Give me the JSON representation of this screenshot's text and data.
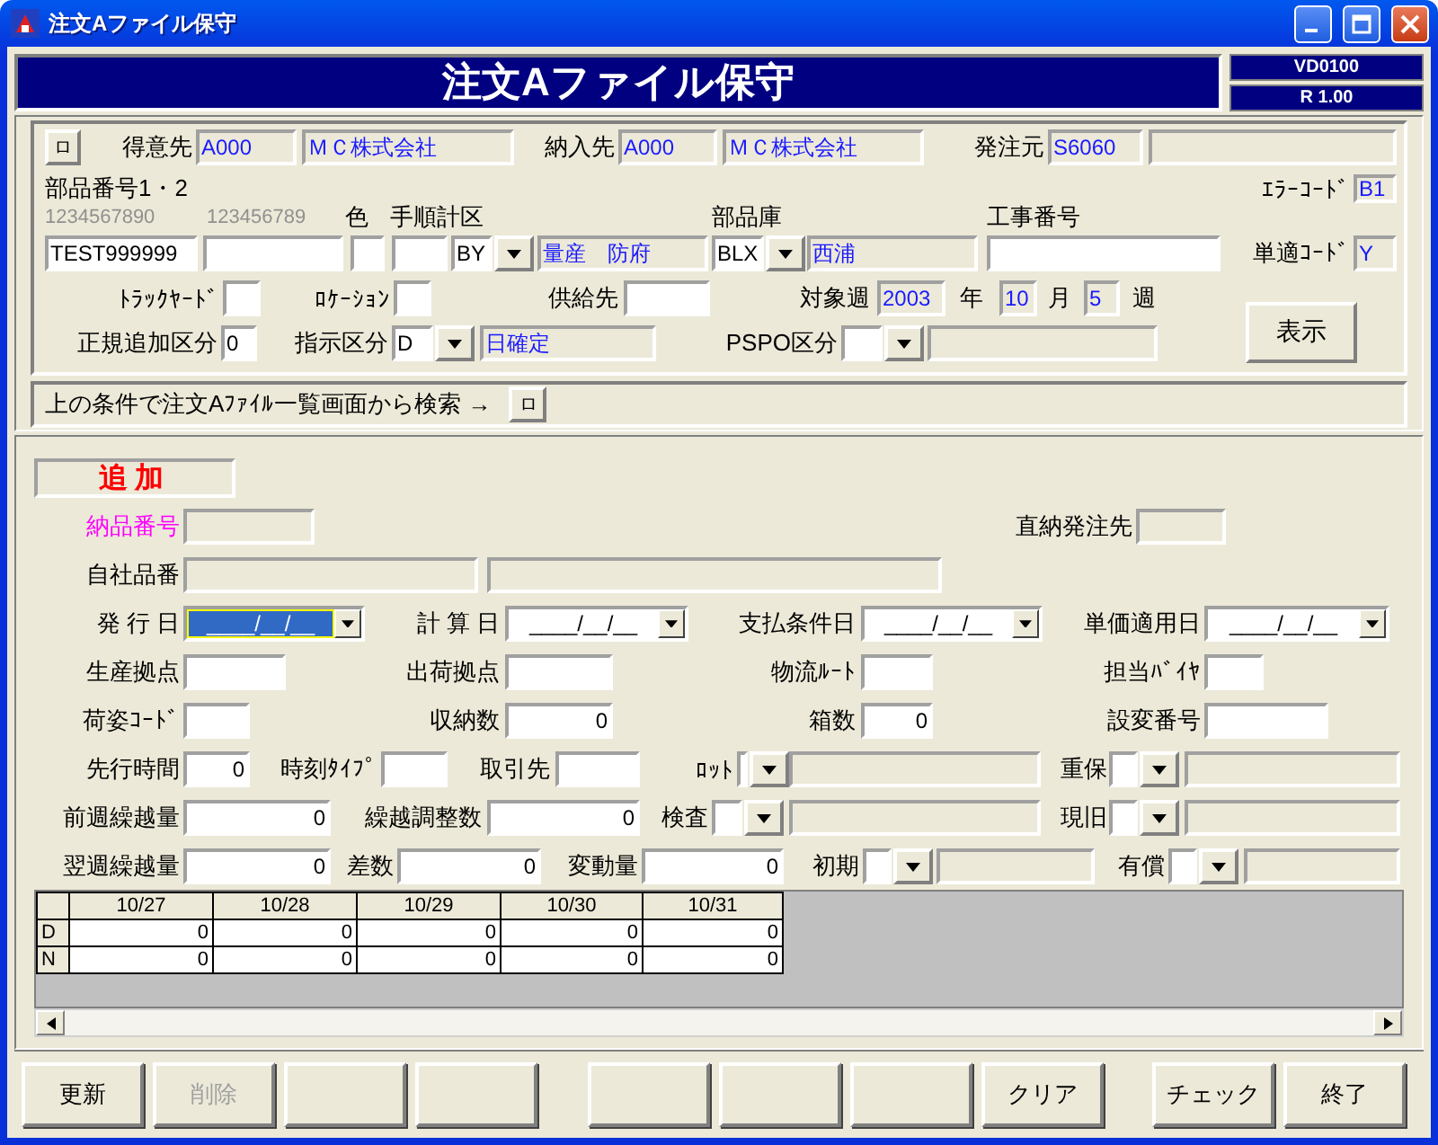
{
  "window": {
    "title": "注文Aファイル保守"
  },
  "header": {
    "title": "注文Aファイル保守",
    "code": "VD0100",
    "revision": "R 1.00"
  },
  "search": {
    "lines": [
      {
        "items": [
          {
            "kind": "button",
            "label": "ロ"
          },
          {
            "kind": "label",
            "text": "得意先"
          },
          {
            "kind": "field",
            "value": "A000",
            "readonly": true
          },
          {
            "kind": "field",
            "value": "ＭＣ株式会社",
            "readonly": true
          },
          {
            "kind": "label",
            "text": "納入先"
          },
          {
            "kind": "field",
            "value": "A000",
            "readonly": true
          },
          {
            "kind": "field",
            "value": "ＭＣ株式会社",
            "readonly": true
          },
          {
            "kind": "label",
            "text": "発注元"
          },
          {
            "kind": "field",
            "value": "S6060",
            "readonly": true
          },
          {
            "kind": "field",
            "readonly": true
          }
        ]
      },
      {
        "items": [
          {
            "kind": "label",
            "text": "部品番号1・2"
          },
          {
            "kind": "label",
            "text": "ｴﾗｰｺｰﾄﾞ"
          },
          {
            "kind": "field",
            "value": "B1",
            "readonly": true
          }
        ]
      },
      {
        "items": [
          {
            "kind": "ruler",
            "text": "1234567890"
          },
          {
            "kind": "ruler",
            "text": "123456789"
          },
          {
            "kind": "label",
            "text": "色"
          },
          {
            "kind": "label",
            "text": "手順計区"
          },
          {
            "kind": "label",
            "text": "部品庫"
          },
          {
            "kind": "label",
            "text": "工事番号"
          }
        ]
      },
      {
        "items": [
          {
            "kind": "field",
            "value": "TEST999999",
            "readonly": false
          },
          {
            "kind": "field",
            "readonly": false
          },
          {
            "kind": "field",
            "readonly": false
          },
          {
            "kind": "field",
            "readonly": false
          },
          {
            "kind": "combo",
            "value": "BY"
          },
          {
            "kind": "field",
            "value": "量産　防府",
            "readonly": true
          },
          {
            "kind": "combo",
            "value": "BLX"
          },
          {
            "kind": "field",
            "value": "西浦",
            "readonly": true
          },
          {
            "kind": "field",
            "readonly": false
          },
          {
            "kind": "label",
            "text": "単適ｺｰﾄﾞ"
          },
          {
            "kind": "field",
            "value": "Y",
            "readonly": true
          }
        ]
      },
      {
        "items": [
          {
            "kind": "label",
            "text": "ﾄﾗｯｸﾔｰﾄﾞ"
          },
          {
            "kind": "field",
            "readonly": false
          },
          {
            "kind": "label",
            "text": "ﾛｹｰｼｮﾝ"
          },
          {
            "kind": "field",
            "readonly": false
          },
          {
            "kind": "label",
            "text": "供給先"
          },
          {
            "kind": "field",
            "readonly": false
          },
          {
            "kind": "label",
            "text": "対象週"
          },
          {
            "kind": "field",
            "value": "2003",
            "readonly": true
          },
          {
            "kind": "label",
            "text": "年"
          },
          {
            "kind": "field",
            "value": "10",
            "readonly": true
          },
          {
            "kind": "label",
            "text": "月"
          },
          {
            "kind": "field",
            "value": "5",
            "readonly": true
          },
          {
            "kind": "label",
            "text": "週"
          }
        ]
      },
      {
        "items": [
          {
            "kind": "label",
            "text": "正規追加区分"
          },
          {
            "kind": "field",
            "value": "0",
            "readonly": false
          },
          {
            "kind": "label",
            "text": "指示区分"
          },
          {
            "kind": "combo",
            "value": "D"
          },
          {
            "kind": "field",
            "value": "日確定",
            "readonly": true
          },
          {
            "kind": "label",
            "text": "PSPO区分"
          },
          {
            "kind": "combo"
          },
          {
            "kind": "field",
            "readonly": true
          }
        ]
      }
    ],
    "show_button": "表示",
    "lookup": {
      "text": "上の条件で注文Aﾌｧｲﾙ一覧画面から検索 →",
      "button": "ロ"
    }
  },
  "detail": {
    "mode": "追加",
    "lines": [
      {
        "items": [
          {
            "kind": "label",
            "text": "納品番号",
            "color": "#ff00ff"
          },
          {
            "kind": "field",
            "readonly": true
          },
          {
            "kind": "label",
            "text": "直納発注先"
          },
          {
            "kind": "field",
            "readonly": true
          }
        ]
      },
      {
        "items": [
          {
            "kind": "label",
            "text": "自社品番"
          },
          {
            "kind": "field",
            "readonly": true
          },
          {
            "kind": "field",
            "readonly": true
          }
        ]
      },
      {
        "items": [
          {
            "kind": "label",
            "text": "発 行 日"
          },
          {
            "kind": "date",
            "mask": "____/__/__",
            "focused": true
          },
          {
            "kind": "label",
            "text": "計 算 日"
          },
          {
            "kind": "date",
            "mask": "____/__/__",
            "focused": false
          },
          {
            "kind": "label",
            "text": "支払条件日"
          },
          {
            "kind": "date",
            "mask": "____/__/__",
            "focused": false
          },
          {
            "kind": "label",
            "text": "単価適用日"
          },
          {
            "kind": "date",
            "mask": "____/__/__",
            "focused": false
          }
        ]
      },
      {
        "items": [
          {
            "kind": "label",
            "text": "生産拠点"
          },
          {
            "kind": "field",
            "readonly": false
          },
          {
            "kind": "label",
            "text": "出荷拠点"
          },
          {
            "kind": "field",
            "readonly": false
          },
          {
            "kind": "label",
            "text": "物流ﾙｰﾄ"
          },
          {
            "kind": "field",
            "readonly": false
          },
          {
            "kind": "label",
            "text": "担当ﾊﾞｲﾔ"
          },
          {
            "kind": "field",
            "readonly": false
          }
        ]
      },
      {
        "items": [
          {
            "kind": "label",
            "text": "荷姿ｺｰﾄﾞ"
          },
          {
            "kind": "field",
            "readonly": false
          },
          {
            "kind": "label",
            "text": "収納数"
          },
          {
            "kind": "field",
            "value": "0",
            "readonly": false
          },
          {
            "kind": "label",
            "text": "箱数"
          },
          {
            "kind": "field",
            "value": "0",
            "readonly": false
          },
          {
            "kind": "label",
            "text": "設変番号"
          },
          {
            "kind": "field",
            "readonly": false
          }
        ]
      },
      {
        "items": [
          {
            "kind": "label",
            "text": "先行時間"
          },
          {
            "kind": "field",
            "value": "0",
            "readonly": false
          },
          {
            "kind": "label",
            "text": "時刻ﾀｲﾌﾟ"
          },
          {
            "kind": "field",
            "readonly": false
          },
          {
            "kind": "label",
            "text": "取引先"
          },
          {
            "kind": "field",
            "readonly": false
          },
          {
            "kind": "label",
            "text": "ﾛｯﾄ"
          },
          {
            "kind": "combo"
          },
          {
            "kind": "field",
            "readonly": true
          },
          {
            "kind": "label",
            "text": "重保"
          },
          {
            "kind": "combo"
          },
          {
            "kind": "field",
            "readonly": true
          }
        ]
      },
      {
        "items": [
          {
            "kind": "label",
            "text": "前週繰越量"
          },
          {
            "kind": "field",
            "value": "0",
            "readonly": false
          },
          {
            "kind": "label",
            "text": "繰越調整数"
          },
          {
            "kind": "field",
            "value": "0",
            "readonly": false
          },
          {
            "kind": "label",
            "text": "検査"
          },
          {
            "kind": "combo"
          },
          {
            "kind": "field",
            "readonly": true
          },
          {
            "kind": "label",
            "text": "現旧"
          },
          {
            "kind": "combo"
          },
          {
            "kind": "field",
            "readonly": true
          }
        ]
      },
      {
        "items": [
          {
            "kind": "label",
            "text": "翌週繰越量"
          },
          {
            "kind": "field",
            "value": "0",
            "readonly": false
          },
          {
            "kind": "label",
            "text": "差数"
          },
          {
            "kind": "field",
            "value": "0",
            "readonly": false
          },
          {
            "kind": "label",
            "text": "変動量"
          },
          {
            "kind": "field",
            "value": "0",
            "readonly": false
          },
          {
            "kind": "label",
            "text": "初期"
          },
          {
            "kind": "combo"
          },
          {
            "kind": "field",
            "readonly": true
          },
          {
            "kind": "label",
            "text": "有償"
          },
          {
            "kind": "combo"
          },
          {
            "kind": "field",
            "readonly": true
          }
        ]
      }
    ]
  },
  "grid": {
    "columns": [
      "10/27",
      "10/28",
      "10/29",
      "10/30",
      "10/31"
    ],
    "rows": [
      {
        "label": "D",
        "values": [
          "0",
          "0",
          "0",
          "0",
          "0"
        ]
      },
      {
        "label": "N",
        "values": [
          "0",
          "0",
          "0",
          "0",
          "0"
        ]
      }
    ]
  },
  "buttons": [
    {
      "label": "更新",
      "disabled": false
    },
    {
      "label": "削除",
      "disabled": true
    },
    {
      "label": "クリア",
      "disabled": false
    },
    {
      "label": "チェック",
      "disabled": false
    },
    {
      "label": "終了",
      "disabled": false
    }
  ]
}
